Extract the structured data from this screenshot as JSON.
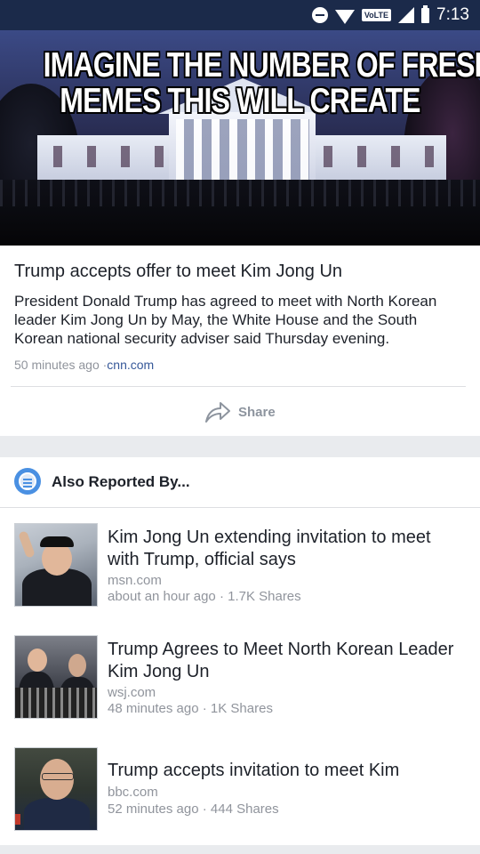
{
  "status_bar": {
    "time": "7:13",
    "network_badge": "VoLTE",
    "icons": [
      "do-not-disturb-icon",
      "wifi-icon",
      "volte-icon",
      "signal-icon",
      "battery-icon"
    ]
  },
  "hero": {
    "meme_line1": "IMAGINE THE NUMBER OF FRESH",
    "meme_line2": "MEMES THIS WILL CREATE"
  },
  "article": {
    "headline": "Trump accepts offer to meet Kim Jong Un",
    "summary": "President Donald Trump has agreed to meet with North Korean leader Kim Jong Un by May, the White House and the South Korean national security adviser said Thursday evening.",
    "time": "50 minutes ago",
    "source_sep": "·",
    "source": "cnn.com",
    "share_label": "Share"
  },
  "related": {
    "title": "Also Reported By...",
    "items": [
      {
        "title": "Kim Jong Un extending invitation to meet with Trump, official says",
        "source": "msn.com",
        "meta": "about an hour ago · 1.7K Shares"
      },
      {
        "title": "Trump Agrees to Meet North Korean Leader Kim Jong Un",
        "source": "wsj.com",
        "meta": "48 minutes ago · 1K Shares"
      },
      {
        "title": "Trump accepts invitation to meet Kim",
        "source": "bbc.com",
        "meta": "52 minutes ago · 444 Shares"
      }
    ]
  },
  "colors": {
    "status_bar": "#1b2a4a",
    "link": "#365899",
    "muted": "#90949c",
    "accent_icon": "#4a90e2"
  }
}
